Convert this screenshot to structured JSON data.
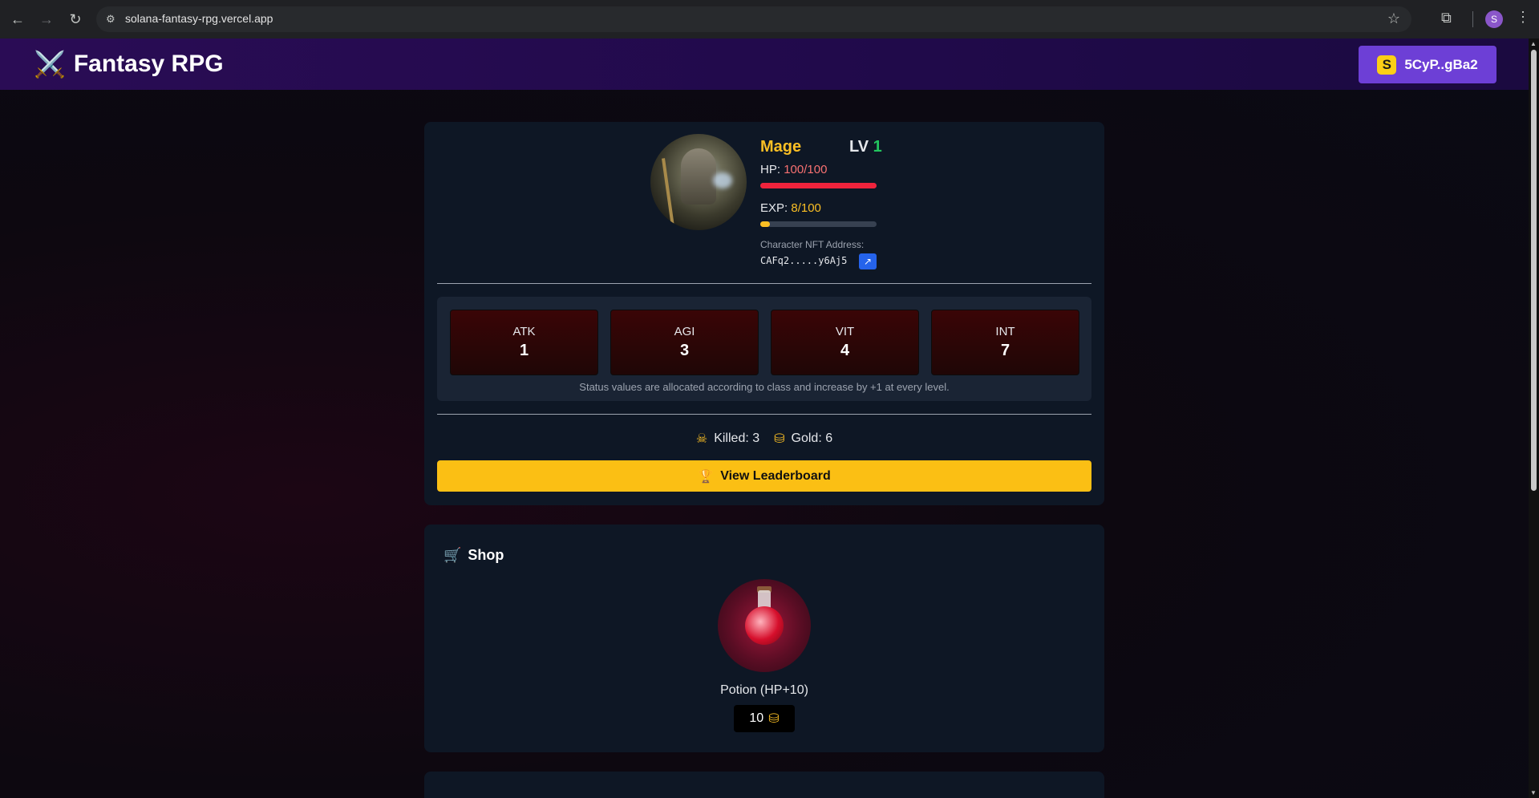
{
  "browser": {
    "url": "solana-fantasy-rpg.vercel.app",
    "profile_initial": "S"
  },
  "header": {
    "title": "Fantasy RPG",
    "logo_icon": "crossed-swords-icon",
    "wallet_label": "5CyP..gBa2",
    "wallet_icon": "solana-icon"
  },
  "character": {
    "class_name": "Mage",
    "level_prefix": "LV",
    "level": "1",
    "hp_prefix": "HP:",
    "hp_value": "100/100",
    "hp_fraction": 1.0,
    "exp_prefix": "EXP:",
    "exp_value": "8/100",
    "exp_fraction": 0.08,
    "nft_label": "Character NFT Address:",
    "nft_address": "CAFq2.....y6Aj5"
  },
  "stats": [
    {
      "name": "ATK",
      "value": "1"
    },
    {
      "name": "AGI",
      "value": "3"
    },
    {
      "name": "VIT",
      "value": "4"
    },
    {
      "name": "INT",
      "value": "7"
    }
  ],
  "stats_note": "Status values are allocated according to class and increase by +1 at every level.",
  "tally": {
    "killed": "Killed: 3",
    "gold": "Gold: 6"
  },
  "leaderboard_label": "View Leaderboard",
  "shop": {
    "title": "Shop",
    "item_name": "Potion (HP+10)",
    "item_price": "10"
  },
  "colors": {
    "accent_purple": "#6d3fd6",
    "gold": "#fbbf14",
    "hp_red": "#ef233c"
  }
}
